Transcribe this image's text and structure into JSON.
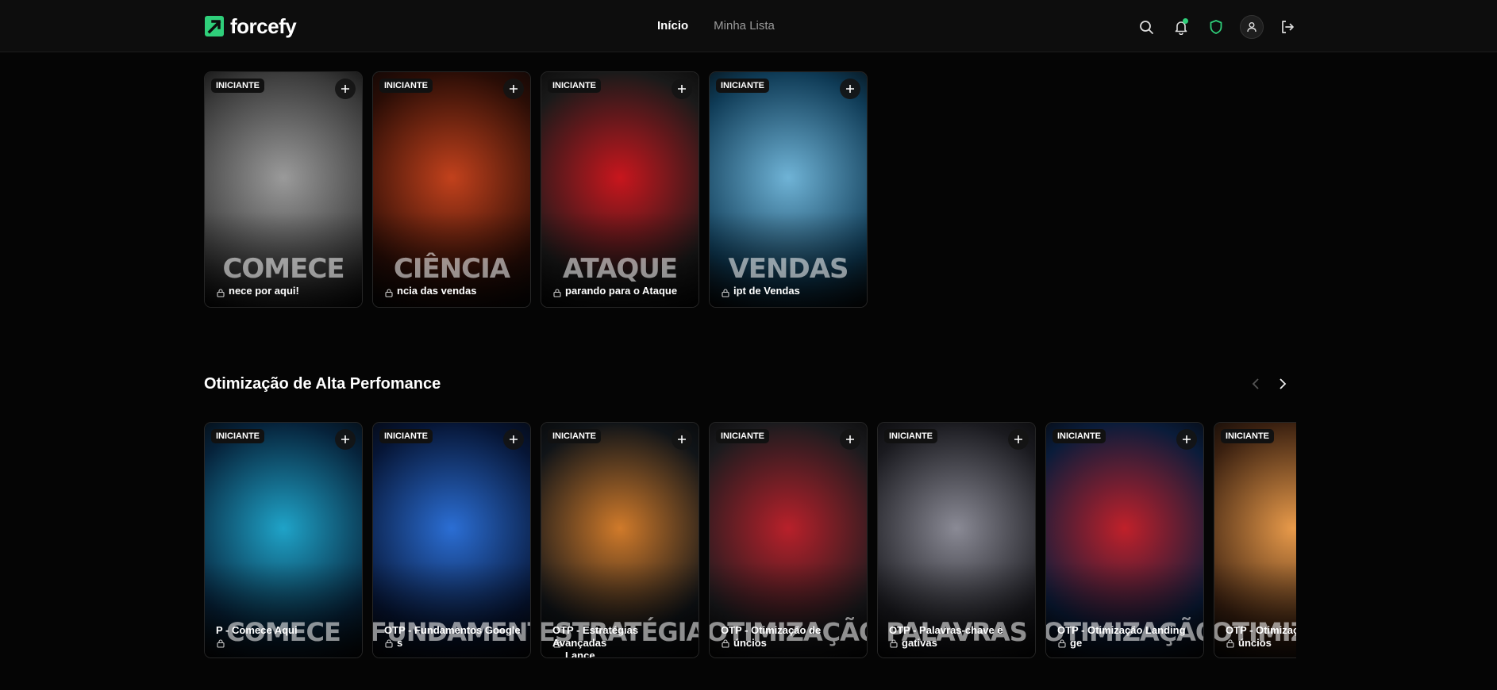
{
  "app": {
    "name": "forcefy",
    "accent": "#2fcf7a"
  },
  "nav": {
    "items": [
      {
        "label": "Início",
        "active": true
      },
      {
        "label": "Minha Lista",
        "active": false
      }
    ]
  },
  "header_icons": [
    "search-icon",
    "bell-icon",
    "shield-icon",
    "user-icon",
    "logout-icon"
  ],
  "row1": {
    "cards": [
      {
        "badge": "INICIANTE",
        "title": "nece por aqui!",
        "bigword": "COMECE",
        "colors": [
          "#3a3a3a",
          "#9a9a9a"
        ]
      },
      {
        "badge": "INICIANTE",
        "title": "ncia das vendas",
        "bigword": "CIÊNCIA",
        "colors": [
          "#2a0d06",
          "#c2411c"
        ]
      },
      {
        "badge": "INICIANTE",
        "title": "parando para o Ataque",
        "bigword": "ATAQUE",
        "colors": [
          "#1a1a1a",
          "#c8161d"
        ]
      },
      {
        "badge": "INICIANTE",
        "title": "ipt de Vendas",
        "bigword": "VENDAS",
        "colors": [
          "#0e3a55",
          "#6fb3d6"
        ]
      }
    ]
  },
  "section": {
    "title": "Otimização de Alta Perfomance"
  },
  "row2": {
    "cards": [
      {
        "badge": "INICIANTE",
        "title1": "P - Comece Aqui",
        "title2": "",
        "bigword": "COMECE",
        "colors": [
          "#06223a",
          "#1fa3c8"
        ]
      },
      {
        "badge": "INICIANTE",
        "title1": "OTP - Fundamentos Google",
        "title2": "s",
        "bigword": "FUNDAMENTOS",
        "colors": [
          "#061535",
          "#2b6ed4"
        ]
      },
      {
        "badge": "INICIANTE",
        "title1": "OTP - Estratégias Avançadas",
        "title2": "Lance",
        "bigword": "ESTRATÉGIAS",
        "colors": [
          "#101418",
          "#d07a2a"
        ]
      },
      {
        "badge": "INICIANTE",
        "title1": "OTP - Otimização de",
        "title2": "úncios",
        "bigword": "OTIMIZAÇÃO",
        "colors": [
          "#1b1b1e",
          "#b8202a"
        ]
      },
      {
        "badge": "INICIANTE",
        "title1": "OTP - Palavras-chave e",
        "title2": "gativas",
        "bigword": "PALAVRAS",
        "colors": [
          "#1a1a1f",
          "#8a8a95"
        ]
      },
      {
        "badge": "INICIANTE",
        "title1": "OTP - Otimização Landing",
        "title2": "ge",
        "bigword": "OTIMIZAÇÃO",
        "colors": [
          "#0a1c3a",
          "#c0202a"
        ]
      },
      {
        "badge": "INICIANTE",
        "title1": "OTP - Otimizaç",
        "title2": "úncios",
        "bigword": "OTIMIZAÇÃO",
        "colors": [
          "#3a2010",
          "#e89a4a"
        ]
      }
    ]
  }
}
